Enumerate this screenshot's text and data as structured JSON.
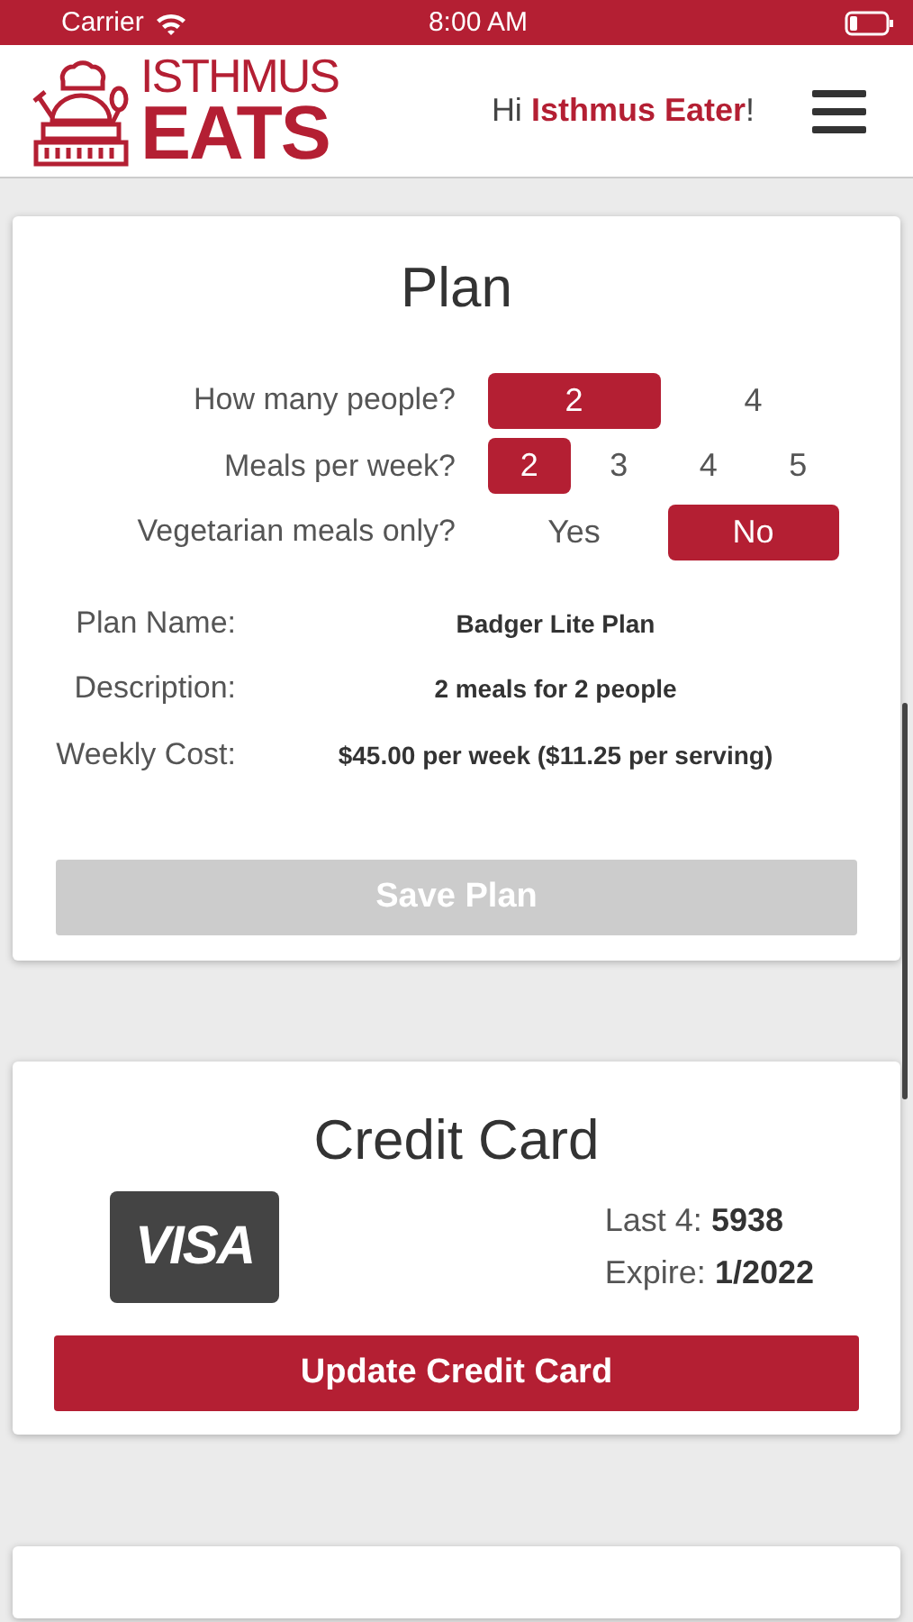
{
  "status_bar": {
    "carrier": "Carrier",
    "time": "8:00 AM"
  },
  "header": {
    "logo_top": "ISTHMUS",
    "logo_bottom": "EATS",
    "greeting": "Hi **Isthmus Eater**!"
  },
  "plan": {
    "title": "Plan",
    "questions": [
      {
        "label": "How many people?",
        "options": [
          {
            "label": "2",
            "selected": true
          },
          {
            "label": "4",
            "selected": false
          }
        ]
      },
      {
        "label": "Meals per week?",
        "options": [
          {
            "label": "2",
            "selected": true
          },
          {
            "label": "3",
            "selected": false
          },
          {
            "label": "4",
            "selected": false
          },
          {
            "label": "5",
            "selected": false
          }
        ]
      },
      {
        "label": "Vegetarian meals only?",
        "options": [
          {
            "label": "Yes",
            "selected": false
          },
          {
            "label": "No",
            "selected": true
          }
        ]
      }
    ],
    "details": [
      {
        "label": "Plan Name:",
        "value": "Badger Lite Plan"
      },
      {
        "label": "Description:",
        "value": "2 meals for 2 people"
      },
      {
        "label": "Weekly Cost:",
        "value": "$45.00 per week ($11.25 per serving)"
      }
    ],
    "save_button": {
      "label": "Save Plan",
      "disabled": true
    }
  },
  "credit_card": {
    "title": "Credit Card",
    "brand": "VISA",
    "last4_label": "Last 4:",
    "last4": "5938",
    "expire_label": "Expire:",
    "expire": "1/2022",
    "update_button": "Update Credit Card"
  }
}
